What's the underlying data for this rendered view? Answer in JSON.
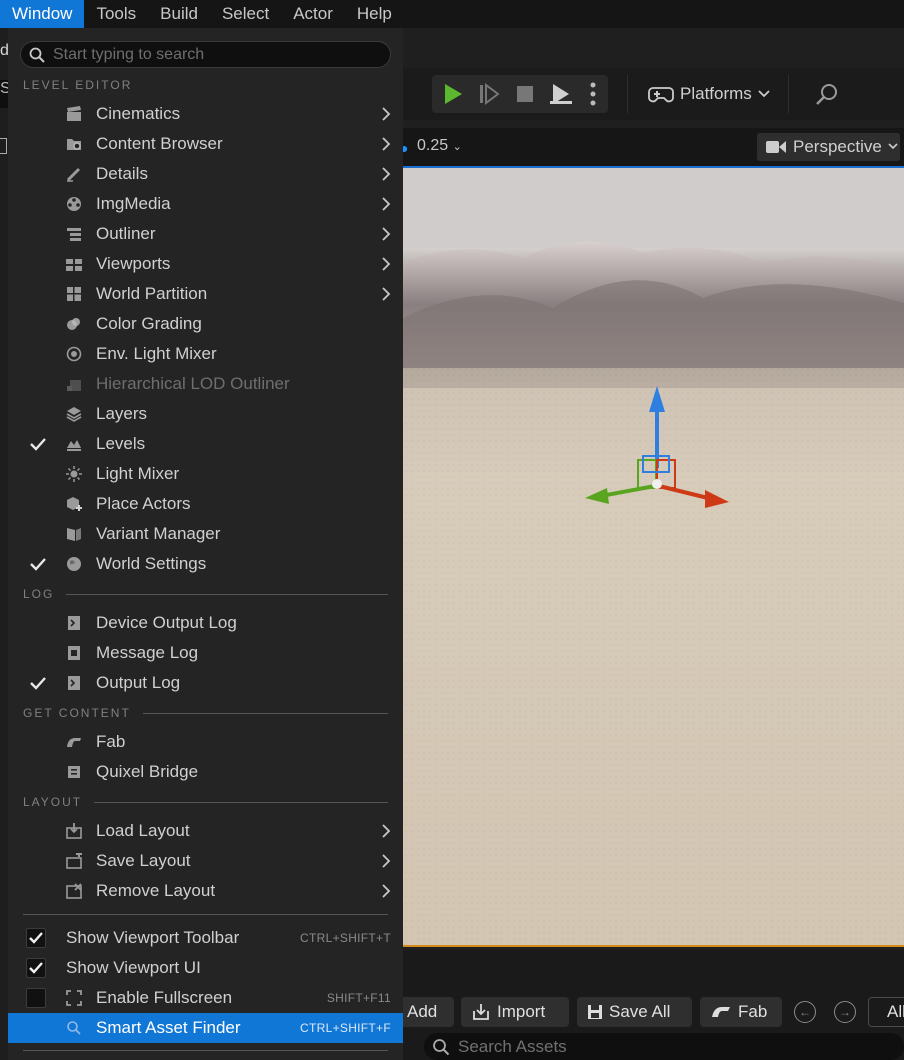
{
  "menubar": {
    "items": [
      {
        "label": "Window",
        "active": true
      },
      {
        "label": "Tools"
      },
      {
        "label": "Build"
      },
      {
        "label": "Select"
      },
      {
        "label": "Actor"
      },
      {
        "label": "Help"
      }
    ]
  },
  "background": {
    "left_partial_text": "d",
    "left_partial_input": "S",
    "toolbar": {
      "platforms_label": "Platforms"
    },
    "viewport": {
      "snap_value": "0.25",
      "perspective_label": "Perspective"
    },
    "content_browser": {
      "add_label": "Add",
      "import_label": "Import",
      "save_all_label": "Save All",
      "fab_label": "Fab",
      "all_label": "All",
      "search_placeholder": "Search Assets"
    }
  },
  "menu": {
    "search_placeholder": "Start typing to search",
    "sections": {
      "level_editor": "LEVEL EDITOR",
      "log": "LOG",
      "get_content": "GET CONTENT",
      "layout": "LAYOUT"
    },
    "level_editor_items": [
      {
        "label": "Cinematics",
        "submenu": true
      },
      {
        "label": "Content Browser",
        "submenu": true
      },
      {
        "label": "Details",
        "submenu": true
      },
      {
        "label": "ImgMedia",
        "submenu": true
      },
      {
        "label": "Outliner",
        "submenu": true
      },
      {
        "label": "Viewports",
        "submenu": true
      },
      {
        "label": "World Partition",
        "submenu": true
      },
      {
        "label": "Color Grading"
      },
      {
        "label": "Env. Light Mixer"
      },
      {
        "label": "Hierarchical LOD Outliner",
        "disabled": true
      },
      {
        "label": "Layers"
      },
      {
        "label": "Levels",
        "checked": true
      },
      {
        "label": "Light Mixer"
      },
      {
        "label": "Place Actors"
      },
      {
        "label": "Variant Manager"
      },
      {
        "label": "World Settings",
        "checked": true
      }
    ],
    "log_items": [
      {
        "label": "Device Output Log"
      },
      {
        "label": "Message Log"
      },
      {
        "label": "Output Log",
        "checked": true
      }
    ],
    "get_content_items": [
      {
        "label": "Fab"
      },
      {
        "label": "Quixel Bridge"
      }
    ],
    "layout_items": [
      {
        "label": "Load Layout",
        "submenu": true
      },
      {
        "label": "Save Layout",
        "submenu": true
      },
      {
        "label": "Remove Layout",
        "submenu": true
      }
    ],
    "toggle_items": [
      {
        "label": "Show Viewport Toolbar",
        "checked": true,
        "shortcut": "CTRL+SHIFT+T"
      },
      {
        "label": "Show Viewport UI",
        "checked": true
      },
      {
        "label": "Enable Fullscreen",
        "checked": false,
        "shortcut": "SHIFT+F11"
      },
      {
        "label": "Smart Asset Finder",
        "shortcut": "CTRL+SHIFT+F",
        "highlighted": true
      }
    ]
  },
  "colors": {
    "accent": "#1177d6",
    "menu_bg": "#242424",
    "play_green": "#5cb82e",
    "gizmo_blue": "#2f7fe0",
    "gizmo_green": "#5aa51f",
    "gizmo_red": "#cf3a16"
  }
}
